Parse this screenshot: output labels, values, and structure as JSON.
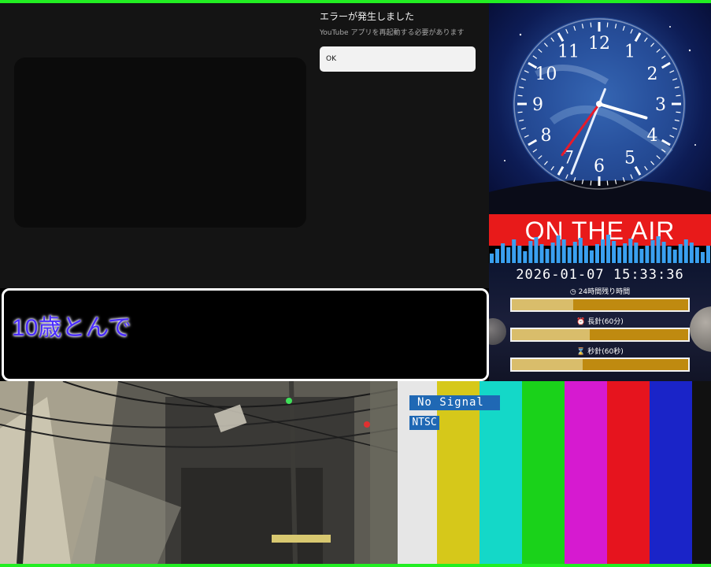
{
  "error_dialog": {
    "title": "エラーが発生しました",
    "message": "YouTube アプリを再起動する必要があります",
    "ok_label": "OK"
  },
  "clock": {
    "numerals": [
      "12",
      "1",
      "2",
      "3",
      "4",
      "5",
      "6",
      "7",
      "8",
      "9",
      "10",
      "11"
    ],
    "hour": 15,
    "minute": 33,
    "second": 36
  },
  "on_air": {
    "label": "ON THE AIR"
  },
  "countdown": {
    "datetime": "2026-01-07 15:33:36",
    "bars": [
      {
        "label": "24時間残り時間",
        "icon": "clock-icon",
        "fill": 0.35
      },
      {
        "label": "長針(60分)",
        "icon": "alarm-clock-icon",
        "fill": 0.44
      },
      {
        "label": "秒針(60秒)",
        "icon": "hourglass-icon",
        "fill": 0.4
      }
    ]
  },
  "subtitle": {
    "text": "10歳とんで"
  },
  "test_pattern": {
    "status": "No Signal",
    "format": "NTSC",
    "bar_colors": [
      "#e6e6e6",
      "#d6c81a",
      "#14d8c8",
      "#1ad21a",
      "#d61ad0",
      "#e6141e",
      "#1a24c8",
      "#111111"
    ]
  },
  "colors": {
    "accent_green": "#22ee22",
    "onair_red": "#e81a1a",
    "gold_bar": "#bf8a10",
    "subtitle_blue": "#4a2cff"
  }
}
